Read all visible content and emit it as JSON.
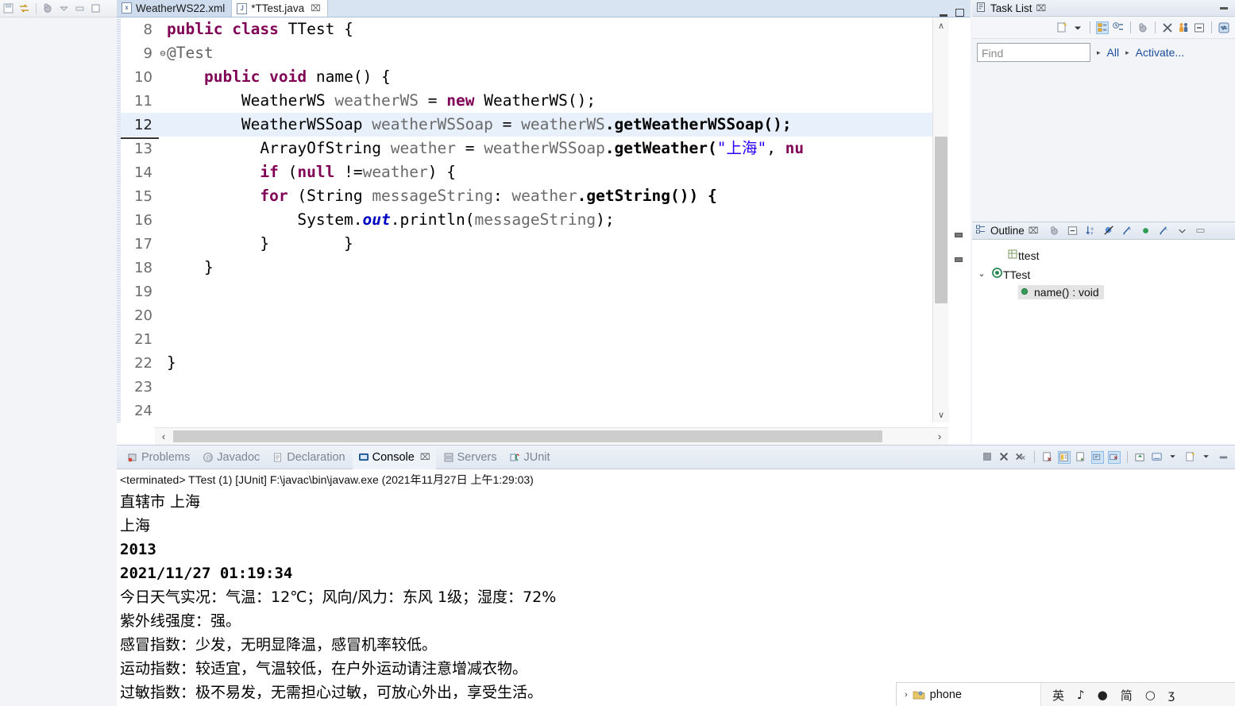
{
  "window": {
    "minimize_label": "minimize",
    "maximize_label": "maximize"
  },
  "top_toolbar": {
    "icons": [
      "save-icon",
      "refresh-icon",
      "debug-icon",
      "dropdown-icon",
      "minimize-icon",
      "restore-icon"
    ]
  },
  "editor": {
    "tabs": [
      {
        "label": "WeatherWS22.xml",
        "icon": "xml-file-icon",
        "icon_letter": "x",
        "active": false,
        "dirty": false
      },
      {
        "label": "*TTest.java",
        "icon": "java-file-icon",
        "icon_letter": "J",
        "active": true,
        "dirty": true,
        "close": "⌧"
      }
    ],
    "lines": [
      {
        "num": "8",
        "fold": "",
        "highlight": false,
        "tokens": [
          {
            "t": "public",
            "c": "kw"
          },
          {
            "t": " ",
            "c": "plain"
          },
          {
            "t": "class",
            "c": "kw"
          },
          {
            "t": " TTest {",
            "c": "plain"
          }
        ]
      },
      {
        "num": "9",
        "fold": "⊖",
        "highlight": false,
        "tokens": [
          {
            "t": "@Test",
            "c": "ann"
          }
        ]
      },
      {
        "num": "10",
        "fold": "",
        "highlight": false,
        "tokens": [
          {
            "t": "    ",
            "c": "plain"
          },
          {
            "t": "public",
            "c": "kw"
          },
          {
            "t": " ",
            "c": "plain"
          },
          {
            "t": "void",
            "c": "kw"
          },
          {
            "t": " name() {",
            "c": "plain"
          }
        ]
      },
      {
        "num": "11",
        "fold": "",
        "highlight": false,
        "tokens": [
          {
            "t": "        WeatherWS ",
            "c": "plain"
          },
          {
            "t": "weatherWS",
            "c": "var"
          },
          {
            "t": " = ",
            "c": "plain"
          },
          {
            "t": "new",
            "c": "kw"
          },
          {
            "t": " WeatherWS();",
            "c": "plain"
          }
        ]
      },
      {
        "num": "12",
        "fold": "",
        "highlight": true,
        "tokens": [
          {
            "t": "        WeatherWSSoap ",
            "c": "plain"
          },
          {
            "t": "weatherWSSoap",
            "c": "var"
          },
          {
            "t": " = ",
            "c": "plain"
          },
          {
            "t": "weatherWS",
            "c": "var"
          },
          {
            "t": ".getWeatherWSSoap();",
            "c": "mth"
          }
        ]
      },
      {
        "num": "13",
        "fold": "",
        "highlight": false,
        "tokens": [
          {
            "t": "          ArrayOfString ",
            "c": "plain"
          },
          {
            "t": "weather",
            "c": "var"
          },
          {
            "t": " = ",
            "c": "plain"
          },
          {
            "t": "weatherWSSoap",
            "c": "var"
          },
          {
            "t": ".getWeather(",
            "c": "mth"
          },
          {
            "t": "\"上海\"",
            "c": "str"
          },
          {
            "t": ", ",
            "c": "plain"
          },
          {
            "t": "nu",
            "c": "kw"
          }
        ]
      },
      {
        "num": "14",
        "fold": "",
        "highlight": false,
        "tokens": [
          {
            "t": "          ",
            "c": "plain"
          },
          {
            "t": "if",
            "c": "kw"
          },
          {
            "t": " (",
            "c": "plain"
          },
          {
            "t": "null",
            "c": "kw"
          },
          {
            "t": " !=",
            "c": "plain"
          },
          {
            "t": "weather",
            "c": "var"
          },
          {
            "t": ") {",
            "c": "plain"
          }
        ]
      },
      {
        "num": "15",
        "fold": "",
        "highlight": false,
        "tokens": [
          {
            "t": "          ",
            "c": "plain"
          },
          {
            "t": "for",
            "c": "kw"
          },
          {
            "t": " (String ",
            "c": "plain"
          },
          {
            "t": "messageString",
            "c": "var"
          },
          {
            "t": ": ",
            "c": "plain"
          },
          {
            "t": "weather",
            "c": "var"
          },
          {
            "t": ".getString()) {",
            "c": "mth"
          }
        ]
      },
      {
        "num": "16",
        "fold": "",
        "highlight": false,
        "tokens": [
          {
            "t": "              System.",
            "c": "plain"
          },
          {
            "t": "out",
            "c": "fld"
          },
          {
            "t": ".println(",
            "c": "plain"
          },
          {
            "t": "messageString",
            "c": "var"
          },
          {
            "t": ");",
            "c": "plain"
          }
        ]
      },
      {
        "num": "17",
        "fold": "",
        "highlight": false,
        "tokens": [
          {
            "t": "          }        }",
            "c": "plain"
          }
        ]
      },
      {
        "num": "18",
        "fold": "",
        "highlight": false,
        "tokens": [
          {
            "t": "    }",
            "c": "plain"
          }
        ]
      },
      {
        "num": "19",
        "fold": "",
        "highlight": false,
        "tokens": []
      },
      {
        "num": "20",
        "fold": "",
        "highlight": false,
        "tokens": []
      },
      {
        "num": "21",
        "fold": "",
        "highlight": false,
        "tokens": []
      },
      {
        "num": "22",
        "fold": "",
        "highlight": false,
        "tokens": [
          {
            "t": "}",
            "c": "plain"
          }
        ]
      },
      {
        "num": "23",
        "fold": "",
        "highlight": false,
        "tokens": []
      },
      {
        "num": "24",
        "fold": "",
        "highlight": false,
        "tokens": []
      }
    ],
    "scroll_up": "∧",
    "scroll_down": "∨",
    "scroll_left": "‹",
    "scroll_right": "›"
  },
  "task_list": {
    "title": "Task List",
    "close": "⌧",
    "find_placeholder": "Find",
    "all_label": "All",
    "activate_label": "Activate...",
    "tri": "▸",
    "toolbar_icons": [
      "new-task-icon",
      "dropdown-icon",
      "categorized-icon",
      "scheduled-icon",
      "focus-icon",
      "filter-icon",
      "people-icon",
      "collapse-all-icon",
      "synchronize-icon"
    ]
  },
  "outline": {
    "title": "Outline",
    "close": "⌧",
    "toolbar_icons": [
      "focus-icon",
      "collapse-all-icon",
      "sort-icon",
      "hide-fields-icon",
      "hide-static-icon",
      "hide-nonpublic-icon",
      "hide-local-icon",
      "menu-icon",
      "minimize-icon"
    ],
    "items": [
      {
        "label": "ttest",
        "icon": "package-icon",
        "indent": 1,
        "chevron": "",
        "selected": false
      },
      {
        "label": "TTest",
        "icon": "class-icon",
        "indent": 0,
        "chevron": "⌄",
        "selected": false
      },
      {
        "label": "name() : void",
        "icon": "method-public-icon",
        "indent": 2,
        "chevron": "",
        "selected": true
      }
    ]
  },
  "console": {
    "tabs": [
      {
        "label": "Problems",
        "icon": "problems-icon",
        "active": false
      },
      {
        "label": "Javadoc",
        "icon": "javadoc-icon",
        "active": false
      },
      {
        "label": "Declaration",
        "icon": "declaration-icon",
        "active": false
      },
      {
        "label": "Console",
        "icon": "console-icon",
        "active": true,
        "close": "⌧"
      },
      {
        "label": "Servers",
        "icon": "servers-icon",
        "active": false
      },
      {
        "label": "JUnit",
        "icon": "junit-icon",
        "active": false
      }
    ],
    "toolbar_icons": [
      "terminate-icon",
      "remove-launch-icon",
      "remove-all-terminated-icon",
      "clear-console-icon",
      "scroll-lock-icon",
      "word-wrap-icon",
      "pin-console-icon",
      "display-selected-console-icon",
      "open-console-icon",
      "new-console-view-icon",
      "dropdown-icon",
      "view-menu-icon",
      "minimize-icon"
    ],
    "status_line": "<terminated> TTest (1) [JUnit] F:\\javac\\bin\\javaw.exe (2021年11月27日 上午1:29:03)",
    "output": [
      "直辖市 上海",
      "上海",
      "2013",
      "2021/11/27 01:19:34",
      "今日天气实况：气温：12℃；风向/风力：东风 1级；湿度：72%",
      "紫外线强度：强。",
      "感冒指数：少发，无明显降温，感冒机率较低。",
      "运动指数：较适宜，气温较低，在户外运动请注意增减衣物。",
      "过敏指数：极不易发，无需担心过敏，可放心外出，享受生活。"
    ]
  },
  "taskbar": {
    "chevron": "›",
    "item_label": "phone",
    "item_icon": "folder-phone-icon",
    "tray_items": [
      "英",
      "♪",
      "●",
      "简",
      "○",
      "ʒ"
    ]
  },
  "colors": {
    "accent": "#1b4f9c",
    "keyword": "#7f0055",
    "string": "#2a00ff",
    "field": "#0000c0",
    "highlight_line": "#e8f0fb",
    "tab_active": "#ffffff",
    "tabbar": "#d9e4f2"
  }
}
